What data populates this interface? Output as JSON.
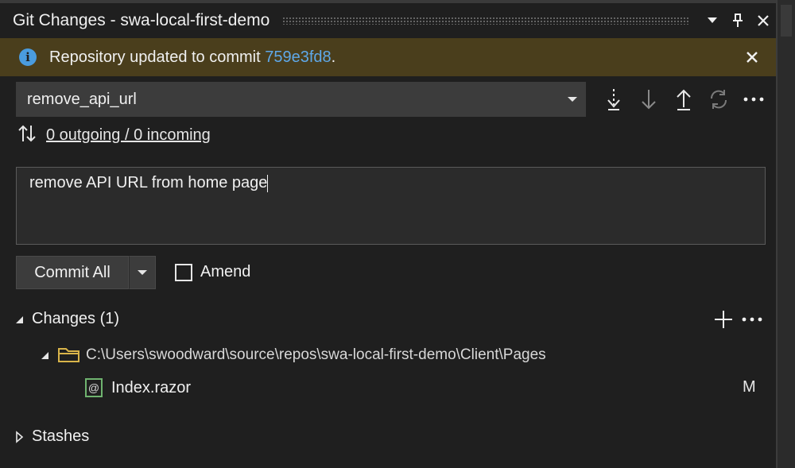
{
  "window": {
    "title": "Git Changes - swa-local-first-demo"
  },
  "infobar": {
    "text_prefix": "Repository updated to commit ",
    "commit_link": "759e3fd8",
    "text_suffix": "."
  },
  "branch": {
    "name": "remove_api_url"
  },
  "sync": {
    "label": "0 outgoing / 0 incoming"
  },
  "commit_message": {
    "value": "remove API URL from home page"
  },
  "commit": {
    "button_label": "Commit All",
    "amend_label": "Amend",
    "amend_checked": false
  },
  "changes": {
    "header": "Changes (1)",
    "folder_path": "C:\\Users\\swoodward\\source\\repos\\swa-local-first-demo\\Client\\Pages",
    "files": [
      {
        "name": "Index.razor",
        "status": "M"
      }
    ]
  },
  "stashes": {
    "header": "Stashes"
  },
  "colors": {
    "background": "#1f1f1f",
    "infobar": "#4a3e1c",
    "link": "#5fa8e8",
    "info_icon": "#4a9cdf",
    "file_icon": "#6fb36f",
    "folder_icon": "#d9b44a"
  }
}
